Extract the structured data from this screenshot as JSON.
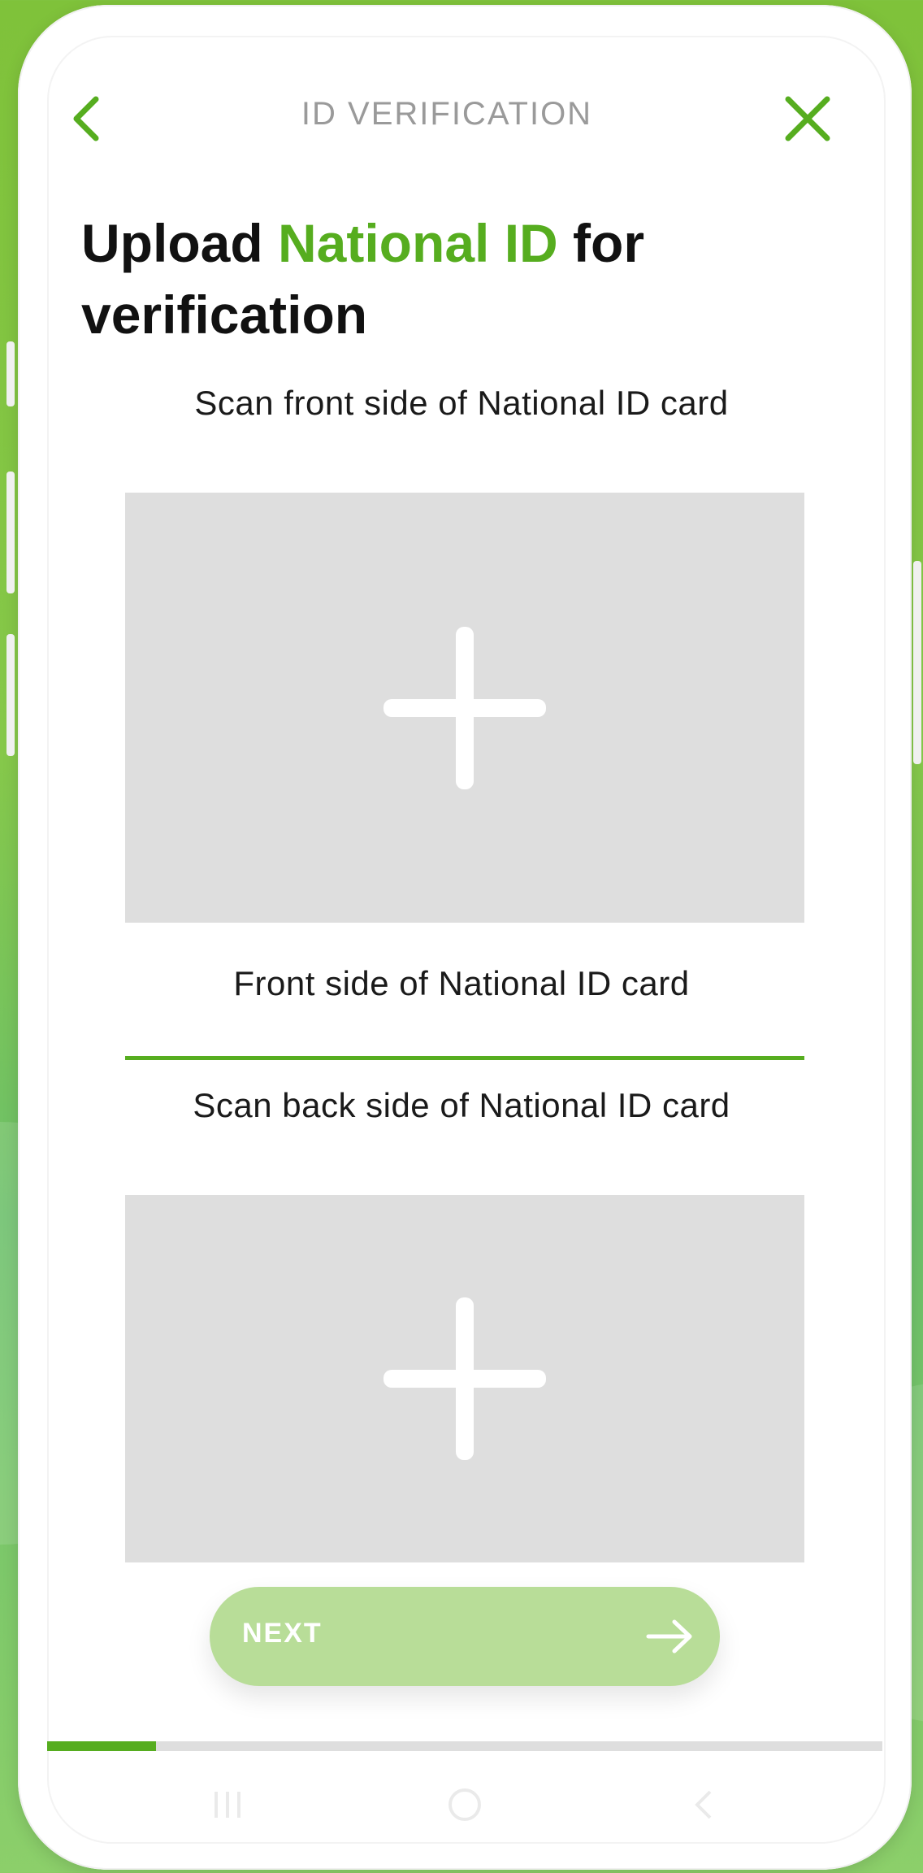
{
  "header": {
    "title": "ID VERIFICATION",
    "back_icon": "chevron-left-icon",
    "close_icon": "close-icon"
  },
  "headline": {
    "part1": "Upload ",
    "accent": "National ID",
    "part2": " for verification"
  },
  "front": {
    "scan_label": "Scan front side of National ID card",
    "caption": "Front side of National ID card"
  },
  "back": {
    "scan_label": "Scan back side of National ID card"
  },
  "next_button": {
    "label": "NEXT",
    "icon": "arrow-right-icon"
  },
  "progress": {
    "fraction": 0.13
  },
  "colors": {
    "accent": "#56ad1f",
    "upload_box": "#dedede",
    "next_button_disabled": "#b8dd98",
    "background": "#7fc23a"
  }
}
